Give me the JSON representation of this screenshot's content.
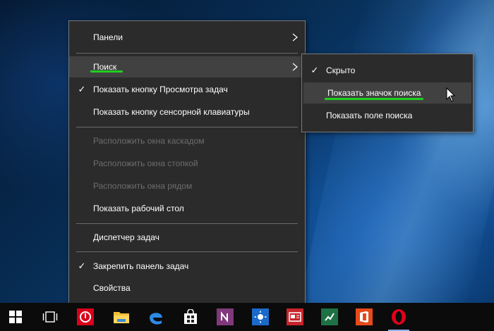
{
  "main_menu": {
    "items": [
      {
        "label": "Панели",
        "checked": false,
        "disabled": false,
        "submenu": true
      },
      {
        "label": "Поиск",
        "checked": false,
        "disabled": false,
        "submenu": true,
        "highlighted": true
      },
      {
        "label": "Показать кнопку Просмотра задач",
        "checked": true,
        "disabled": false
      },
      {
        "label": "Показать кнопку сенсорной клавиатуры",
        "checked": false,
        "disabled": false
      },
      {
        "label": "Расположить окна каскадом",
        "checked": false,
        "disabled": true
      },
      {
        "label": "Расположить окна стопкой",
        "checked": false,
        "disabled": true
      },
      {
        "label": "Расположить окна рядом",
        "checked": false,
        "disabled": true
      },
      {
        "label": "Показать рабочий стол",
        "checked": false,
        "disabled": false
      },
      {
        "label": "Диспетчер задач",
        "checked": false,
        "disabled": false
      },
      {
        "label": "Закрепить панель задач",
        "checked": true,
        "disabled": false
      },
      {
        "label": "Свойства",
        "checked": false,
        "disabled": false
      }
    ]
  },
  "search_submenu": {
    "items": [
      {
        "label": "Скрыто",
        "checked": true
      },
      {
        "label": "Показать значок поиска",
        "checked": false,
        "highlighted": true
      },
      {
        "label": "Показать поле поиска",
        "checked": false
      }
    ]
  },
  "check_glyph": "✓",
  "taskbar": {
    "icons": [
      "windows-start-icon",
      "task-view-icon",
      "opera-button-icon",
      "file-explorer-icon",
      "edge-icon",
      "store-icon",
      "onenote-icon",
      "weather-icon",
      "news-icon",
      "excel-icon",
      "office-icon",
      "opera-icon"
    ]
  },
  "colors": {
    "menu_bg": "#2b2b2b",
    "hover_bg": "#414141",
    "disabled_text": "#6d6d6d",
    "annotation_underline": "#1fd01f"
  }
}
